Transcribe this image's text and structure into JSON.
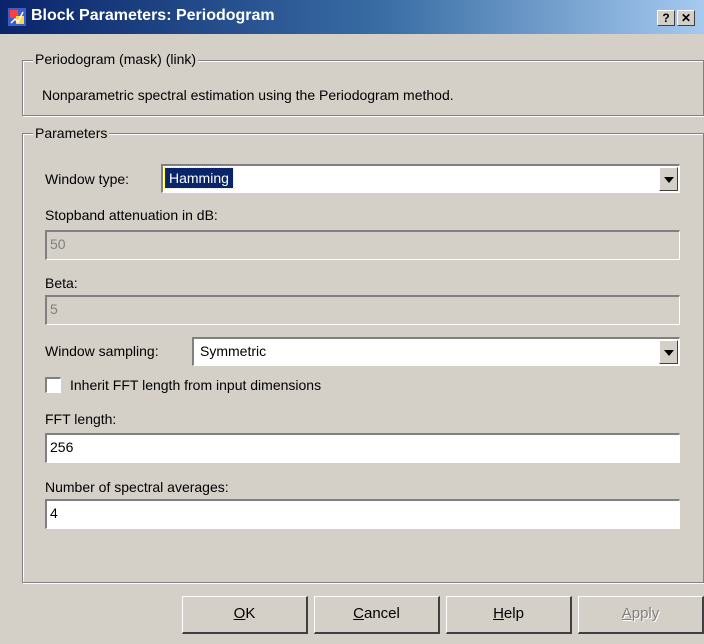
{
  "window": {
    "title": "Block Parameters: Periodogram",
    "help_button": "?",
    "close_button": "✕"
  },
  "mask_group": {
    "legend": "Periodogram (mask) (link)",
    "description": "Nonparametric spectral estimation using the Periodogram method."
  },
  "params_group": {
    "legend": "Parameters",
    "window_type": {
      "label": "Window type:",
      "value": "Hamming"
    },
    "stopband": {
      "label": "Stopband attenuation in dB:",
      "value": "50"
    },
    "beta": {
      "label": "Beta:",
      "value": "5"
    },
    "window_sampling": {
      "label": "Window sampling:",
      "value": "Symmetric"
    },
    "inherit_fft": {
      "label": "Inherit FFT length from input dimensions",
      "checked": false
    },
    "fft_length": {
      "label": "FFT length:",
      "value": "256"
    },
    "spectral_averages": {
      "label": "Number of spectral averages:",
      "value": "4"
    }
  },
  "buttons": {
    "ok": {
      "accel": "O",
      "rest": "K"
    },
    "cancel": {
      "accel": "C",
      "rest": "ancel"
    },
    "help": {
      "accel": "H",
      "rest": "elp"
    },
    "apply": {
      "accel": "A",
      "rest": "pply",
      "enabled": false
    }
  },
  "colors": {
    "title_start": "#0a246a",
    "title_end": "#a6caf0",
    "face": "#d4d0c8",
    "selection": "#0a246a"
  }
}
